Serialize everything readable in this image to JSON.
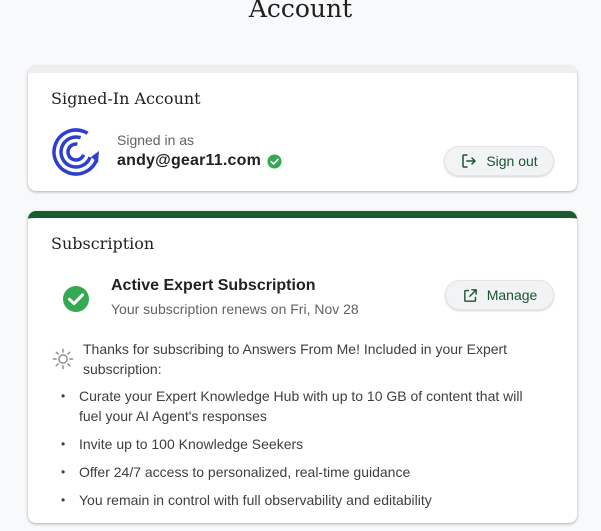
{
  "page": {
    "title": "Account"
  },
  "account": {
    "title": "Signed-In Account",
    "signed_in_label": "Signed in as",
    "email": "andy@gear11.com",
    "sign_out_label": "Sign out"
  },
  "subscription": {
    "title": "Subscription",
    "status": "Active Expert Subscription",
    "renewal": "Your subscription renews on Fri, Nov 28",
    "manage_label": "Manage",
    "thanks": "Thanks for subscribing to Answers From Me! Included in your Expert subscription:",
    "benefits": [
      "Curate your Expert Knowledge Hub with up to 10 GB of content that will fuel your AI Agent's responses",
      "Invite up to 100 Knowledge Seekers",
      "Offer 24/7 access to personalized, real-time guidance",
      "You remain in control with full observability and editability"
    ],
    "bullet": "•"
  },
  "colors": {
    "accent_green": "#195d2e",
    "check_green": "#34a853",
    "logo_blue": "#2c3fcf",
    "button_text": "#1a5632"
  },
  "icons": {
    "verified": "verified-check-icon",
    "sign_out": "logout-icon",
    "manage": "open-in-new-icon",
    "status": "check-circle-icon",
    "info": "sun-icon",
    "logo": "gear11-logo"
  }
}
